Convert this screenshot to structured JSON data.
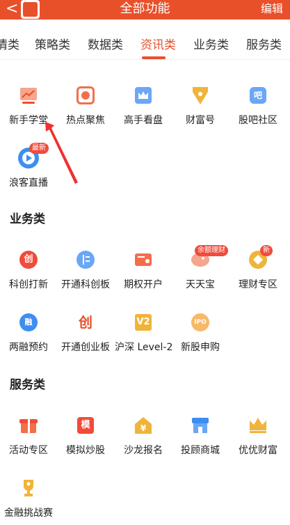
{
  "header": {
    "back_glyph": "<",
    "title": "全部功能",
    "edit_label": "编辑"
  },
  "tabs": [
    {
      "label": "情类"
    },
    {
      "label": "策略类"
    },
    {
      "label": "数据类"
    },
    {
      "label": "资讯类",
      "active": true
    },
    {
      "label": "业务类"
    },
    {
      "label": "服务类"
    }
  ],
  "news_items": [
    {
      "label": "新手学堂",
      "icon": "chart-monitor-icon"
    },
    {
      "label": "热点聚焦",
      "icon": "focus-target-icon"
    },
    {
      "label": "高手看盘",
      "icon": "crown-box-icon"
    },
    {
      "label": "财富号",
      "icon": "pen-nib-icon"
    },
    {
      "label": "股吧社区",
      "icon": "chat-bubble-icon",
      "glyph": "吧"
    },
    {
      "label": "浪客直播",
      "icon": "live-play-icon",
      "badge": "最新"
    }
  ],
  "business": {
    "title": "业务类",
    "items": [
      {
        "label": "科创打新",
        "icon": "star-innovation-icon",
        "glyph": "创"
      },
      {
        "label": "开通科创板",
        "icon": "board-open-icon"
      },
      {
        "label": "期权开户",
        "icon": "certificate-icon"
      },
      {
        "label": "天天宝",
        "icon": "piggy-bank-icon",
        "badge": "余额理财"
      },
      {
        "label": "理财专区",
        "icon": "coin-icon",
        "badge": "新"
      },
      {
        "label": "两融预约",
        "icon": "margin-icon",
        "glyph": "融"
      },
      {
        "label": "开通创业板",
        "icon": "growth-board-icon",
        "glyph": "创"
      },
      {
        "label": "沪深 Level-2",
        "icon": "level2-icon",
        "glyph": "V2"
      },
      {
        "label": "新股申购",
        "icon": "ipo-icon",
        "glyph": "IPO"
      }
    ]
  },
  "service": {
    "title": "服务类",
    "items": [
      {
        "label": "活动专区",
        "icon": "gift-icon"
      },
      {
        "label": "模拟炒股",
        "icon": "simulate-icon",
        "glyph": "模"
      },
      {
        "label": "沙龙报名",
        "icon": "salon-house-icon",
        "glyph": "¥"
      },
      {
        "label": "投顾商城",
        "icon": "store-icon"
      },
      {
        "label": "优优财富",
        "icon": "crown-icon"
      },
      {
        "label": "金融挑战赛",
        "icon": "trophy-icon"
      }
    ]
  },
  "colors": {
    "accent": "#e8502a",
    "blue": "#3d8ef0",
    "gold": "#f0b43a",
    "red": "#f04b3c"
  }
}
